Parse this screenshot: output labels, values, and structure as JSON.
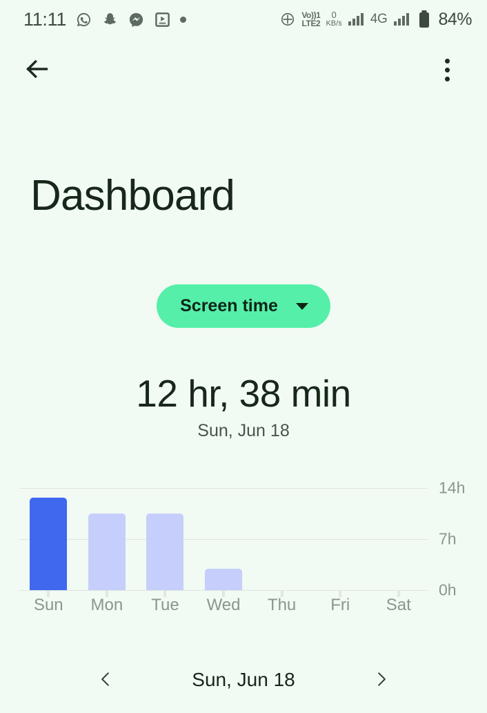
{
  "status_bar": {
    "clock": "11:11",
    "app_icons": [
      "whatsapp-icon",
      "snapchat-icon",
      "messenger-icon",
      "video-player-icon"
    ],
    "more_notifications_dot": true,
    "volte_line1": "Vo))1",
    "volte_line2": "LTE2",
    "net_speed_value": "0",
    "net_speed_unit": "KB/s",
    "network_type": "4G",
    "battery": "84%"
  },
  "app_bar": {
    "back_label": "Back",
    "overflow_label": "More options"
  },
  "page": {
    "title": "Dashboard"
  },
  "filter_chip": {
    "label": "Screen time"
  },
  "summary": {
    "total": "12 hr, 38 min",
    "date": "Sun, Jun 18"
  },
  "chart_data": {
    "type": "bar",
    "title": "Screen time",
    "xlabel": "",
    "ylabel": "",
    "categories": [
      "Sun",
      "Mon",
      "Tue",
      "Wed",
      "Thu",
      "Fri",
      "Sat"
    ],
    "values": [
      12.63,
      10.5,
      10.5,
      2.9,
      0,
      0,
      0
    ],
    "value_labels": [
      "12 hr, 38 min",
      "",
      "",
      "",
      "",
      "",
      ""
    ],
    "ylim": [
      0,
      15.6
    ],
    "ytick_values": [
      0,
      7,
      14
    ],
    "ytick_labels": [
      "0h",
      "7h",
      "14h"
    ],
    "grid": true,
    "legend": "none",
    "selected_index": 0,
    "colors": {
      "selected_bar": "#3f68ef",
      "bar": "#c6cefb",
      "gridline": "#dfe5df",
      "tick_label": "#8b968c"
    }
  },
  "date_nav": {
    "prev_label": "Previous day",
    "current": "Sun, Jun 18",
    "next_label": "Next day"
  },
  "theme": {
    "background": "#f1faf3",
    "accent_green": "#55efa9",
    "text_primary": "#17271a",
    "text_secondary": "#8b968c"
  }
}
